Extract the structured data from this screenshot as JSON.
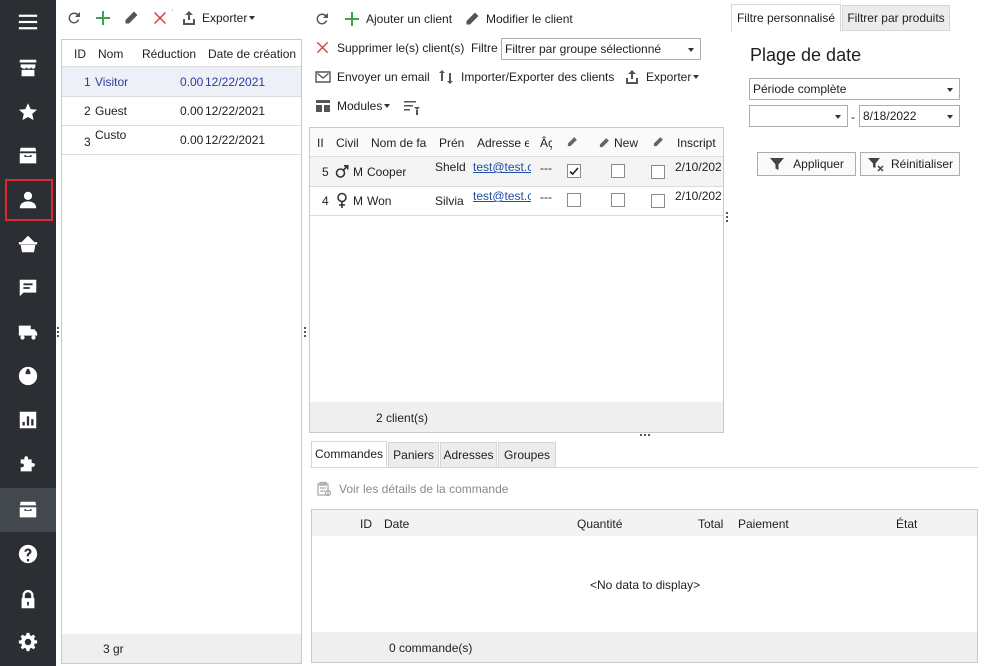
{
  "sidebar": {
    "items": [
      {
        "icon": "menu-icon"
      },
      {
        "icon": "store-icon"
      },
      {
        "icon": "star-icon"
      },
      {
        "icon": "inbox-icon"
      },
      {
        "icon": "customer-icon"
      },
      {
        "icon": "basket-icon"
      },
      {
        "icon": "comment-icon"
      },
      {
        "icon": "truck-icon"
      },
      {
        "icon": "globe-icon"
      },
      {
        "icon": "stats-icon"
      },
      {
        "icon": "puzzle-icon"
      },
      {
        "icon": "archive-icon"
      },
      {
        "icon": "help-icon"
      },
      {
        "icon": "lock-icon"
      },
      {
        "icon": "settings-icon"
      }
    ],
    "active_index": 4
  },
  "groups_panel": {
    "toolbar": {
      "export_label": "Exporter"
    },
    "columns": [
      "ID",
      "Nom",
      "Réduction",
      "Date de création"
    ],
    "rows": [
      {
        "id": "1",
        "name": "Visitor",
        "reduction": "0.00",
        "date": "12/22/2021"
      },
      {
        "id": "2",
        "name": "Guest",
        "reduction": "0.00",
        "date": "12/22/2021"
      },
      {
        "id": "3",
        "name": "Custo",
        "reduction": "0.00",
        "date": "12/22/2021"
      }
    ],
    "footer": "3 gr"
  },
  "clients_panel": {
    "toolbar": {
      "add_label": "Ajouter un client",
      "edit_label": "Modifier le client",
      "delete_label": "Supprimer le(s) client(s)",
      "filter_label": "Filtre",
      "filter_value": "Filtrer par groupe sélectionné",
      "email_label": "Envoyer un email",
      "import_export_label": "Importer/Exporter des clients",
      "export_label": "Exporter",
      "modules_label": "Modules"
    },
    "columns": [
      "II",
      "Civil",
      "Nom de fa",
      "Prén",
      "Adresse e",
      "Âç",
      "",
      "New",
      "",
      "Inscript"
    ],
    "rows": [
      {
        "id": "5",
        "civ_icon": "male-icon",
        "civ": "M",
        "last": "Cooper",
        "first": "Sheld",
        "email": "test@test.c",
        "age": "---",
        "checked": true,
        "date": "2/10/202"
      },
      {
        "id": "4",
        "civ_icon": "female-icon",
        "civ": "M",
        "last": "Won",
        "first": "Silvia",
        "email": "test@test.c",
        "age": "---",
        "checked": false,
        "date": "2/10/202"
      }
    ],
    "footer": "2 client(s)"
  },
  "orders_panel": {
    "tabs": [
      "Commandes",
      "Paniers",
      "Adresses",
      "Groupes"
    ],
    "active_tab": 0,
    "view_details_label": "Voir les détails de la commande",
    "columns": [
      "ID",
      "Date",
      "Quantité",
      "Total",
      "Paiement",
      "État"
    ],
    "empty_text": "<No data to display>",
    "footer": "0 commande(s)"
  },
  "filter_panel": {
    "tabs": [
      "Filtre personnalisé",
      "Filtrer par produits"
    ],
    "active_tab": 0,
    "title": "Plage de date",
    "period_value": "Période complète",
    "date_from": "",
    "date_separator": "-",
    "date_to": "8/18/2022",
    "apply_label": "Appliquer",
    "reset_label": "Réinitialiser"
  },
  "colors": {
    "sidebar": "#2b2e33",
    "active_border": "#e0282e",
    "add_green": "#3ca34c",
    "delete_red": "#d9363e",
    "link": "#1f4fa6",
    "selected_row_text": "#2e3a9e"
  }
}
